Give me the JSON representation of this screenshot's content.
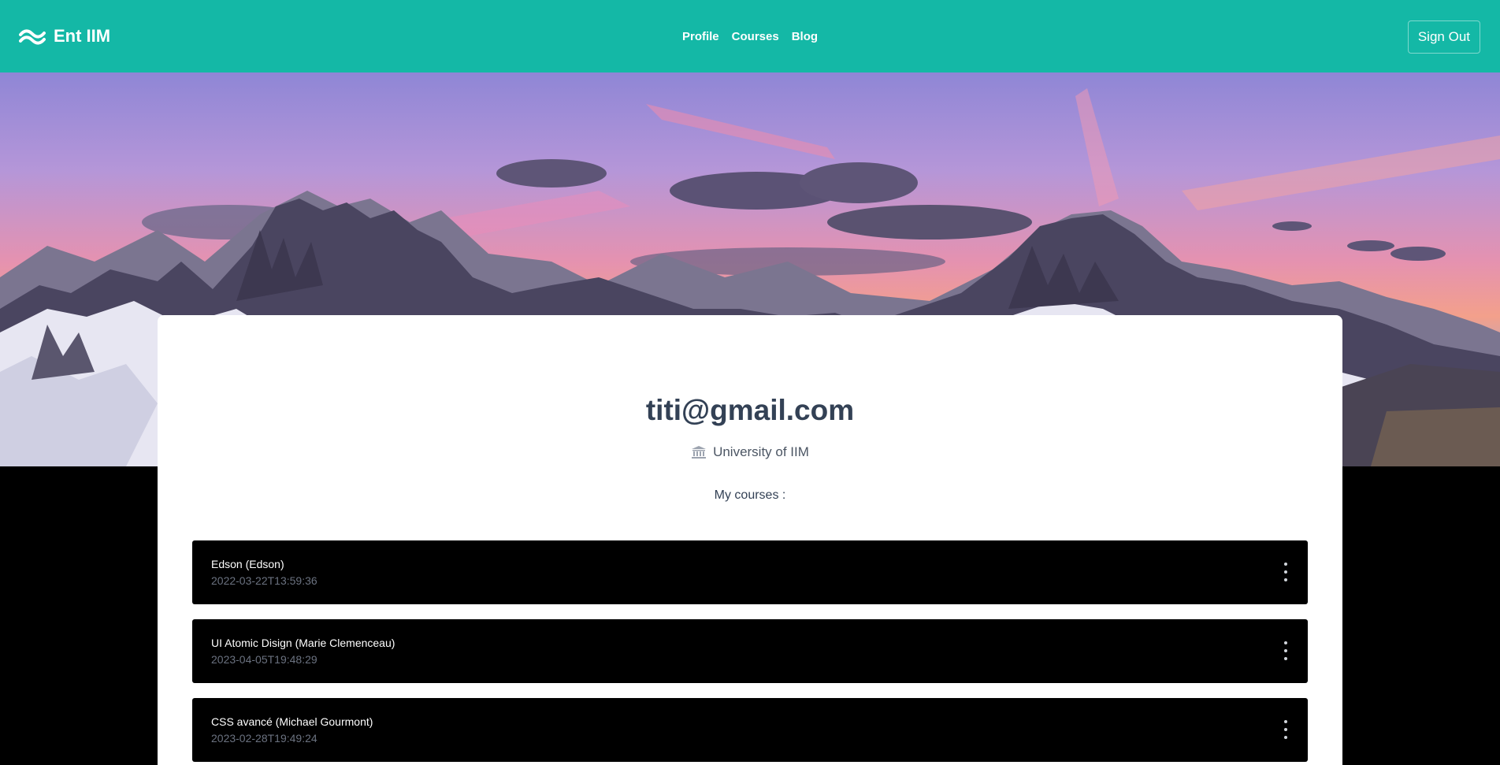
{
  "header": {
    "brand": "Ent IIM",
    "nav": [
      "Profile",
      "Courses",
      "Blog"
    ],
    "sign_out": "Sign Out",
    "brand_color": "#14b8a6"
  },
  "profile": {
    "email": "titi@gmail.com",
    "university": "University of IIM",
    "courses_label": "My courses :"
  },
  "courses": [
    {
      "name": "Edson (Edson)",
      "date": "2022-03-22T13:59:36"
    },
    {
      "name": "UI Atomic Disign (Marie Clemenceau)",
      "date": "2023-04-05T19:48:29"
    },
    {
      "name": "CSS avancé (Michael Gourmont)",
      "date": "2023-02-28T19:49:24"
    }
  ]
}
